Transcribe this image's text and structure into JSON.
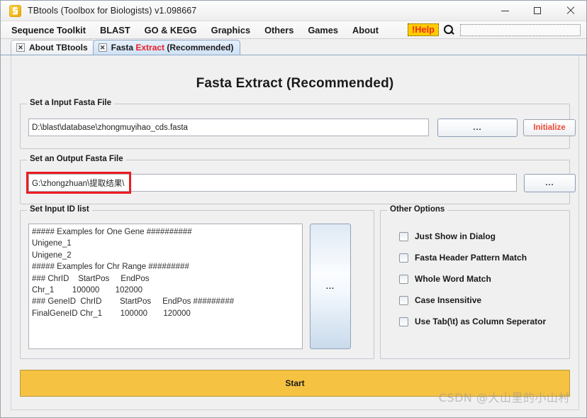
{
  "window": {
    "title": "TBtools (Toolbox for Biologists) v1.098667",
    "app_icon": "tbtools-logo-icon",
    "controls": {
      "minimize": "minimize-icon",
      "maximize": "maximize-icon",
      "close": "close-icon"
    }
  },
  "menubar": {
    "items": [
      {
        "label": "Sequence Toolkit"
      },
      {
        "label": "BLAST"
      },
      {
        "label": "GO & KEGG"
      },
      {
        "label": "Graphics"
      },
      {
        "label": "Others"
      },
      {
        "label": "Games"
      },
      {
        "label": "About"
      }
    ],
    "help_label": "!Help",
    "help_bg": "#ffcc00",
    "help_fg": "#ef2a16",
    "search_icon": "search-icon",
    "search_value": "",
    "search_placeholder": ""
  },
  "tabs": [
    {
      "label": "About TBtools",
      "active": false,
      "close_glyph": "✕"
    },
    {
      "label_pre": "Fasta ",
      "label_hl": "Extract",
      "label_post": " (Recommended)",
      "active": true,
      "close_glyph": "✕"
    }
  ],
  "main": {
    "title": "Fasta Extract (Recommended)",
    "input_group": {
      "title": "Set a Input Fasta File",
      "path_value": "D:\\blast\\database\\zhongmuyihao_cds.fasta",
      "browse_label": "...",
      "initialize_label": "Initialize",
      "initialize_color": "#f04a35"
    },
    "output_group": {
      "title": "Set an Output Fasta File",
      "path_value": "G:\\zhongzhuan\\提取结果\\",
      "browse_label": "...",
      "annotation_color": "#ee1b23"
    },
    "idlist_group": {
      "title": "Set Input ID list",
      "content": "##### Examples for One Gene ##########\nUnigene_1\nUnigene_2\n##### Examples for Chr Range #########\n### ChrID    StartPos     EndPos\nChr_1        100000       102000\n### GeneID  ChrID        StartPos     EndPos #########\nFinalGeneID Chr_1        100000       120000",
      "side_button_label": "..."
    },
    "options_group": {
      "title": "Other Options",
      "items": [
        {
          "label": "Just Show in Dialog",
          "checked": false
        },
        {
          "label": "Fasta Header Pattern Match",
          "checked": false
        },
        {
          "label": "Whole Word Match",
          "checked": false
        },
        {
          "label": "Case Insensitive",
          "checked": false
        },
        {
          "label": "Use Tab(\\t) as Column Seperator",
          "checked": false
        }
      ]
    },
    "start_button": {
      "label": "Start",
      "bg": "#f5c242"
    }
  },
  "watermark": "CSDN @大山里的小山村"
}
